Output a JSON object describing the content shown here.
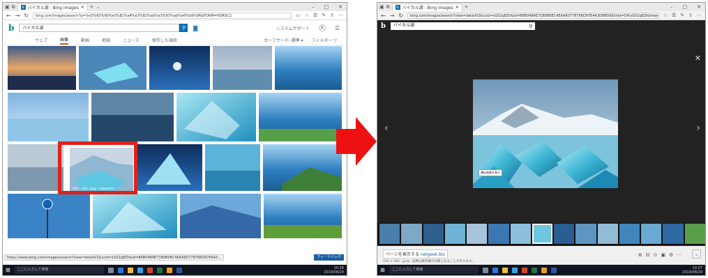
{
  "browser": {
    "tab_title": "バイカル湖 - Bing images",
    "window_controls": [
      "–",
      "□",
      "✕"
    ],
    "left_url": "bing.com/images/search?q=%e3%83%90%e3%82%a4%e3%82%ab%e3%83%ab%e6%b9%96&FORM=HDRSC2",
    "right_url": "bing.com/images/search?view=detailV2&ccid=sG52q8Zh&id=86B04B4E71B0B0EC4EAA60778766D97E4A3D6BD6&thid=OIP.sG52q8ZhbmaeUzPWwYzzaAHaE8..."
  },
  "bing": {
    "logo": "b",
    "query": "バイカル湖",
    "signin": "システムサポート",
    "avatar": "R",
    "scopes": [
      "ウェブ",
      "画像",
      "動画",
      "地図",
      "ニュース",
      "保存した項目"
    ],
    "active_scope": "画像",
    "safesearch": "セーフサーチ: 標準 ▾",
    "filter": "フィルター ▽"
  },
  "grid_thumb_info": "556 × 400 · jpeg · netgeek.biz",
  "status_url": "https://www.bing.com/images/search?view=detailV2&ccid=sG52q8Zh&id=86B04B4E71B0B0EC4EAA60778766D97E4A3...",
  "feedback": "フィードバック",
  "taskbar": {
    "search_placeholder": "ここに入力して検索",
    "left_time": "10:26",
    "left_date": "2019/08/29",
    "right_time": "10:27",
    "right_date": "2019/08/29"
  },
  "viewer": {
    "tooltip": "類似画像を表示",
    "visit_label": "ページを表示する",
    "visit_site": "netgeek.biz",
    "meta": "556 × 400 · jpeg · 画像は著作権の対象となることがあります。",
    "actions_more": "···"
  },
  "colors": {
    "highlight": "#e32119",
    "arrow": "#ee1111",
    "bing_blue": "#0d6cb3"
  }
}
